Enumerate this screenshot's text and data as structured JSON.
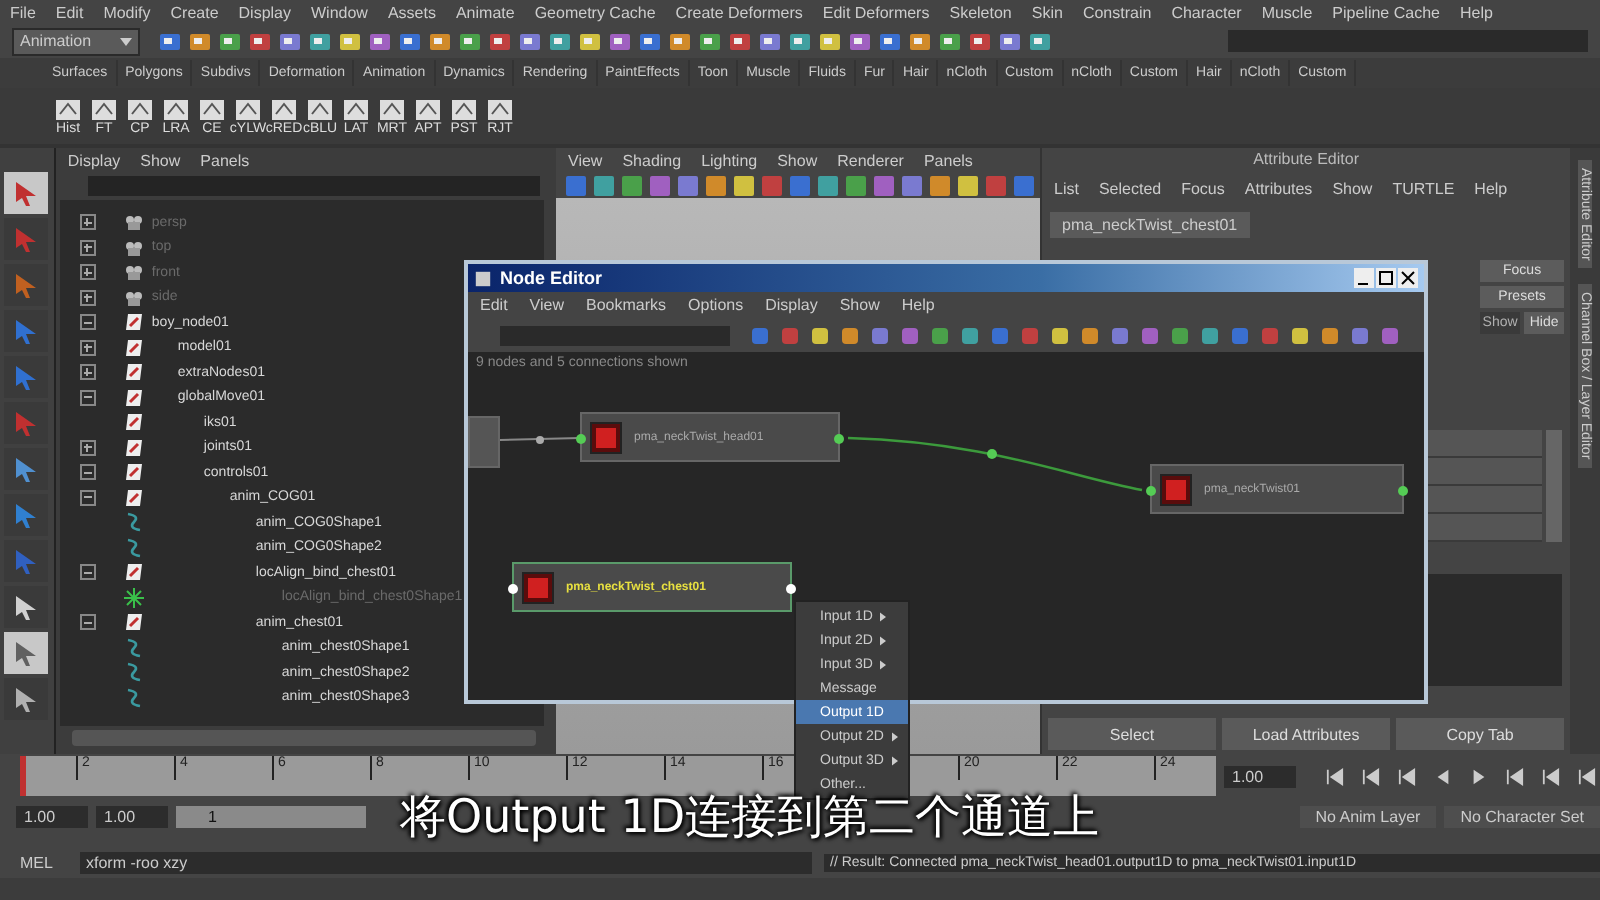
{
  "menu_bar": [
    "File",
    "Edit",
    "Modify",
    "Create",
    "Display",
    "Window",
    "Assets",
    "Animate",
    "Geometry Cache",
    "Create Deformers",
    "Edit Deformers",
    "Skeleton",
    "Skin",
    "Constrain",
    "Character",
    "Muscle",
    "Pipeline Cache",
    "Help"
  ],
  "mode_menu": {
    "value": "Animation"
  },
  "shelf_tabs": [
    "Surfaces",
    "Polygons",
    "Subdivs",
    "Deformation",
    "Animation",
    "Dynamics",
    "Rendering",
    "PaintEffects",
    "Toon",
    "Muscle",
    "Fluids",
    "Fur",
    "Hair",
    "nCloth",
    "Custom",
    "nCloth",
    "Custom",
    "Hair",
    "nCloth",
    "Custom"
  ],
  "shelf": [
    "Hist",
    "FT",
    "CP",
    "LRA",
    "CE",
    "cYLW",
    "cRED",
    "cBLU",
    "LAT",
    "MRT",
    "APT",
    "PST",
    "RJT"
  ],
  "toolbox": [
    {
      "selected": true
    },
    {
      "selected": false
    },
    {
      "selected": false
    },
    {
      "selected": false
    },
    {
      "selected": false
    },
    {
      "selected": false
    },
    {
      "selected": false
    },
    {
      "selected": false
    },
    {
      "selected": false
    },
    {
      "selected": false
    },
    {
      "selected": true
    },
    {
      "selected": false
    }
  ],
  "outliner": {
    "menu": [
      "Display",
      "Show",
      "Panels"
    ],
    "items": [
      {
        "label": "persp",
        "kind": "camera",
        "dimmed": true,
        "expanded": false
      },
      {
        "label": "top",
        "kind": "camera",
        "dimmed": true,
        "expanded": false
      },
      {
        "label": "front",
        "kind": "camera",
        "dimmed": true,
        "expanded": false
      },
      {
        "label": "side",
        "kind": "camera",
        "dimmed": true,
        "expanded": false
      },
      {
        "label": "boy_node01",
        "kind": "transform",
        "dimmed": false,
        "expanded": true,
        "children": [
          {
            "label": "model01",
            "kind": "transform",
            "dimmed": false,
            "expanded": false
          },
          {
            "label": "extraNodes01",
            "kind": "transform",
            "dimmed": false,
            "expanded": false
          },
          {
            "label": "globalMove01",
            "kind": "transform",
            "dimmed": false,
            "expanded": true,
            "children": [
              {
                "label": "iks01",
                "kind": "transform",
                "dimmed": false
              },
              {
                "label": "joints01",
                "kind": "transform",
                "dimmed": false,
                "expanded": false
              },
              {
                "label": "controls01",
                "kind": "transform",
                "dimmed": false,
                "expanded": true,
                "children": [
                  {
                    "label": "anim_COG01",
                    "kind": "transform",
                    "dimmed": false,
                    "expanded": true,
                    "children": [
                      {
                        "label": "anim_COG0Shape1",
                        "kind": "curve",
                        "dimmed": false
                      },
                      {
                        "label": "anim_COG0Shape2",
                        "kind": "curve",
                        "dimmed": false
                      },
                      {
                        "label": "locAlign_bind_chest01",
                        "kind": "transform",
                        "dimmed": false,
                        "expanded": true,
                        "children": [
                          {
                            "label": "locAlign_bind_chest0Shape1",
                            "kind": "locator",
                            "dimmed": true
                          }
                        ]
                      },
                      {
                        "label": "anim_chest01",
                        "kind": "transform",
                        "dimmed": false,
                        "expanded": true,
                        "children": [
                          {
                            "label": "anim_chest0Shape1",
                            "kind": "curve",
                            "dimmed": false
                          },
                          {
                            "label": "anim_chest0Shape2",
                            "kind": "curve",
                            "dimmed": false
                          },
                          {
                            "label": "anim_chest0Shape3",
                            "kind": "curve",
                            "dimmed": false
                          }
                        ]
                      }
                    ]
                  }
                ]
              }
            ]
          }
        ]
      }
    ]
  },
  "viewport": {
    "menu": [
      "View",
      "Shading",
      "Lighting",
      "Show",
      "Renderer",
      "Panels"
    ]
  },
  "attribute_editor": {
    "title": "Attribute Editor",
    "menu": [
      "List",
      "Selected",
      "Focus",
      "Attributes",
      "Show",
      "TURTLE",
      "Help"
    ],
    "tab": "pma_neckTwist_chest01",
    "side_buttons": [
      {
        "label": "Focus",
        "disabled": false
      },
      {
        "label": "Presets",
        "disabled": false
      },
      {
        "label": "Show",
        "disabled": true
      },
      {
        "label": "Hide",
        "disabled": false
      }
    ],
    "bottom_buttons": [
      "Select",
      "Load Attributes",
      "Copy Tab"
    ]
  },
  "side_tabs": [
    "Attribute Editor",
    "Channel Box / Layer Editor"
  ],
  "node_editor": {
    "title": "Node Editor",
    "menu": [
      "Edit",
      "View",
      "Bookmarks",
      "Options",
      "Display",
      "Show",
      "Help"
    ],
    "status": "9 nodes and 5 connections shown",
    "nodes": [
      {
        "name": "pma_neckTwist_head01",
        "selected": false
      },
      {
        "name": "pma_neckTwist_chest01",
        "selected": true
      },
      {
        "name": "pma_neckTwist01",
        "selected": false
      }
    ]
  },
  "context_menu": [
    {
      "label": "Input 1D",
      "submenu": true,
      "selected": false
    },
    {
      "label": "Input 2D",
      "submenu": true,
      "selected": false
    },
    {
      "label": "Input 3D",
      "submenu": true,
      "selected": false
    },
    {
      "label": "Message",
      "submenu": false,
      "selected": false
    },
    {
      "label": "Output 1D",
      "submenu": false,
      "selected": true
    },
    {
      "label": "Output 2D",
      "submenu": true,
      "selected": false
    },
    {
      "label": "Output 3D",
      "submenu": true,
      "selected": false
    },
    {
      "label": "Other...",
      "submenu": false,
      "selected": false
    }
  ],
  "timeline": {
    "ticks": [
      "2",
      "4",
      "6",
      "8",
      "10",
      "12",
      "14",
      "16",
      "20",
      "22",
      "24"
    ],
    "level": 0.0,
    "current_frame": "1.00"
  },
  "range_bar": {
    "start": "1.00",
    "inner_start": "1.00",
    "slider_label": "1",
    "level": 1.0,
    "anim_layer": "No Anim Layer",
    "character_set": "No Character Set"
  },
  "command_line": {
    "language": "MEL",
    "command": "xform -roo xzy",
    "result": "// Result: Connected pma_neckTwist_head01.output1D to pma_neckTwist01.input1D"
  },
  "subtitle": "将Output 1D连接到第二个通道上"
}
